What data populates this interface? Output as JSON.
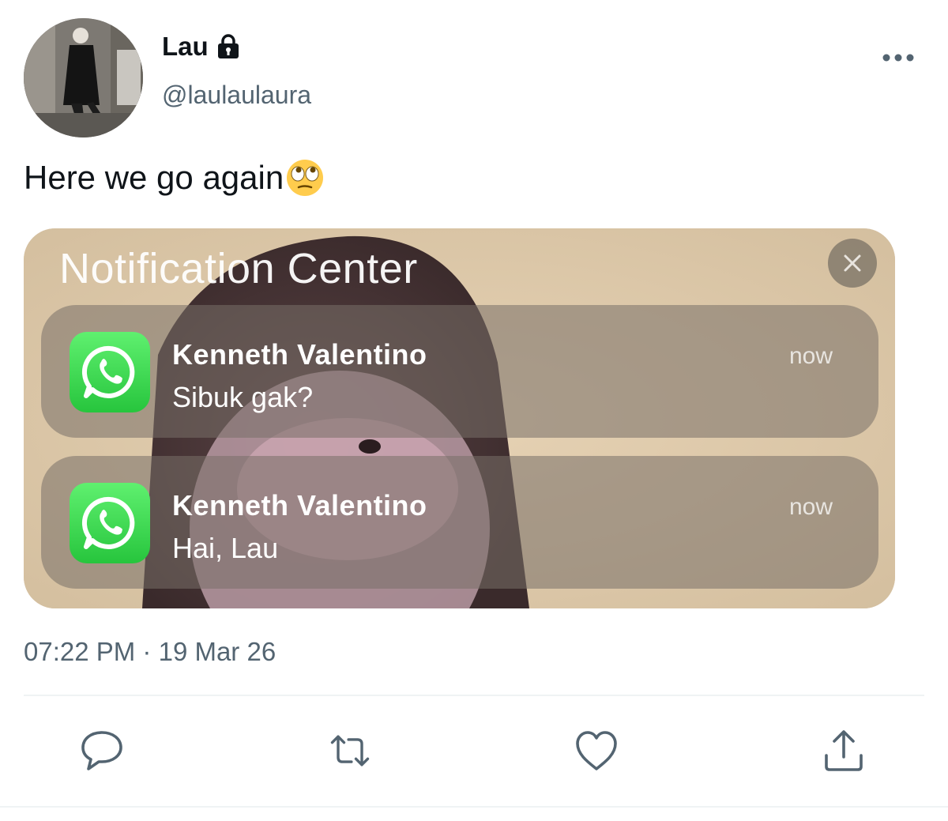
{
  "tweet": {
    "display_name": "Lau",
    "handle": "@laulaulaura",
    "text": "Here we go again",
    "emoji": "face-with-rolling-eyes-icon",
    "time": "07:22 PM",
    "separator": "·",
    "date": "19 Mar 26"
  },
  "notification_center": {
    "title": "Notification Center",
    "close_icon": "close-icon",
    "notifications": [
      {
        "app_icon": "whatsapp-icon",
        "sender": "Kenneth Valentino",
        "message": "Sibuk gak?",
        "time": "now"
      },
      {
        "app_icon": "whatsapp-icon",
        "sender": "Kenneth Valentino",
        "message": "Hai, Lau",
        "time": "now"
      }
    ]
  },
  "actions": [
    "reply-icon",
    "retweet-icon",
    "like-icon",
    "share-icon"
  ],
  "colors": {
    "text_primary": "#0f1419",
    "text_secondary": "#536471",
    "divider": "#eff3f4",
    "whatsapp_green": "#27c53d"
  }
}
